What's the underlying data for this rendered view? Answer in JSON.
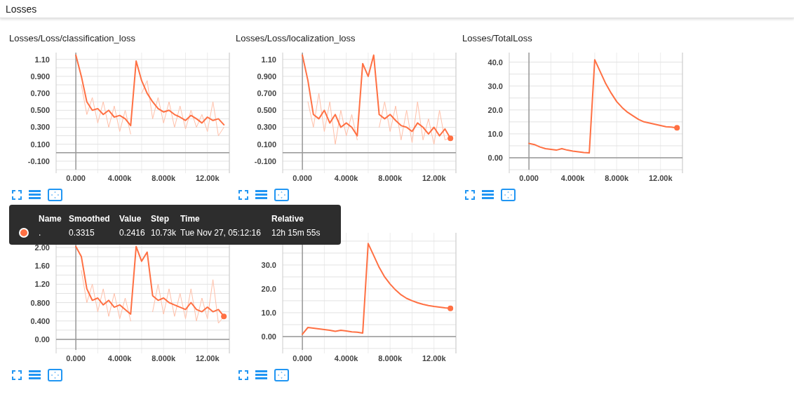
{
  "header": {
    "title": "Losses"
  },
  "charts": [
    {
      "title": "Losses/Loss/classification_loss",
      "end_marker": false,
      "chart_data": {
        "type": "line",
        "grid": true,
        "x": [
          0,
          500,
          1000,
          1500,
          2000,
          2500,
          3000,
          3500,
          4000,
          4500,
          5000,
          5500,
          6000,
          6500,
          7000,
          7500,
          8000,
          8500,
          9000,
          9500,
          10000,
          10500,
          11000,
          11500,
          12000,
          12500,
          13000,
          13500
        ],
        "xlim": [
          -1800,
          14000
        ],
        "ylim": [
          -0.2,
          1.18
        ],
        "xticks": [
          {
            "value": 0,
            "label": "0.000"
          },
          {
            "value": 4000,
            "label": "4.000k"
          },
          {
            "value": 8000,
            "label": "8.000k"
          },
          {
            "value": 12000,
            "label": "12.00k"
          }
        ],
        "yticks": [
          {
            "value": -0.1,
            "label": "-0.100"
          },
          {
            "value": 0.1,
            "label": "0.100"
          },
          {
            "value": 0.3,
            "label": "0.300"
          },
          {
            "value": 0.5,
            "label": "0.500"
          },
          {
            "value": 0.7,
            "label": "0.700"
          },
          {
            "value": 0.9,
            "label": "0.900"
          },
          {
            "value": 1.1,
            "label": "1.10"
          }
        ],
        "series": [
          {
            "color": "#ffbfa8",
            "values": [
              null,
              0.8,
              0.45,
              0.65,
              0.35,
              0.6,
              0.3,
              0.55,
              0.25,
              0.5,
              0.22,
              null,
              0.7,
              0.85,
              0.4,
              0.65,
              0.35,
              0.6,
              0.3,
              0.55,
              0.28,
              0.5,
              0.3,
              0.45,
              0.25,
              0.6,
              0.2,
              0.3
            ]
          },
          {
            "color": "#ff7043",
            "values": [
              1.15,
              0.9,
              0.6,
              0.5,
              0.52,
              0.45,
              0.5,
              0.42,
              0.44,
              0.4,
              0.32,
              1.08,
              0.85,
              0.7,
              0.6,
              0.52,
              0.48,
              0.5,
              0.45,
              0.42,
              0.38,
              0.44,
              0.4,
              0.35,
              0.42,
              0.38,
              0.4,
              0.33
            ]
          }
        ]
      }
    },
    {
      "title": "Losses/Loss/localization_loss",
      "end_marker": true,
      "chart_data": {
        "type": "line",
        "grid": true,
        "x": [
          0,
          500,
          1000,
          1500,
          2000,
          2500,
          3000,
          3500,
          4000,
          4500,
          5000,
          5500,
          6000,
          6500,
          7000,
          7500,
          8000,
          8500,
          9000,
          9500,
          10000,
          10500,
          11000,
          11500,
          12000,
          12500,
          13000,
          13500
        ],
        "xlim": [
          -1800,
          14000
        ],
        "ylim": [
          -0.2,
          1.18
        ],
        "xticks": [
          {
            "value": 0,
            "label": "0.000"
          },
          {
            "value": 4000,
            "label": "4.000k"
          },
          {
            "value": 8000,
            "label": "8.000k"
          },
          {
            "value": 12000,
            "label": "12.00k"
          }
        ],
        "yticks": [
          {
            "value": -0.1,
            "label": "-0.100"
          },
          {
            "value": 0.1,
            "label": "0.100"
          },
          {
            "value": 0.3,
            "label": "0.300"
          },
          {
            "value": 0.5,
            "label": "0.500"
          },
          {
            "value": 0.7,
            "label": "0.700"
          },
          {
            "value": 0.9,
            "label": "0.900"
          },
          {
            "value": 1.1,
            "label": "1.10"
          }
        ],
        "series": [
          {
            "color": "#ffbfa8",
            "values": [
              null,
              0.6,
              0.3,
              0.7,
              0.25,
              0.6,
              0.1,
              0.5,
              0.2,
              0.45,
              0.15,
              null,
              null,
              null,
              0.3,
              0.6,
              0.25,
              0.55,
              0.15,
              0.5,
              0.12,
              0.6,
              0.15,
              0.4,
              0.1,
              0.5,
              0.15,
              0.18
            ]
          },
          {
            "color": "#ff7043",
            "values": [
              1.15,
              0.85,
              0.45,
              0.4,
              0.5,
              0.35,
              0.45,
              0.3,
              0.35,
              0.3,
              0.2,
              1.05,
              0.9,
              1.15,
              0.45,
              0.4,
              0.45,
              0.38,
              0.32,
              0.3,
              0.25,
              0.35,
              0.3,
              0.22,
              0.3,
              0.2,
              0.28,
              0.17
            ]
          }
        ]
      }
    },
    {
      "title": "Losses/TotalLoss",
      "end_marker": true,
      "chart_data": {
        "type": "line",
        "grid": true,
        "x": [
          0,
          500,
          1000,
          1500,
          2000,
          2500,
          3000,
          3500,
          4000,
          4500,
          5000,
          5500,
          6000,
          6500,
          7000,
          7500,
          8000,
          8500,
          9000,
          9500,
          10000,
          10500,
          11000,
          11500,
          12000,
          12500,
          13000,
          13500
        ],
        "xlim": [
          -1800,
          14000
        ],
        "ylim": [
          -5,
          44
        ],
        "xticks": [
          {
            "value": 0,
            "label": "0.000"
          },
          {
            "value": 4000,
            "label": "4.000k"
          },
          {
            "value": 8000,
            "label": "8.000k"
          },
          {
            "value": 12000,
            "label": "12.00k"
          }
        ],
        "yticks": [
          {
            "value": 0,
            "label": "0.00"
          },
          {
            "value": 10,
            "label": "10.0"
          },
          {
            "value": 20,
            "label": "20.0"
          },
          {
            "value": 30,
            "label": "30.0"
          },
          {
            "value": 40,
            "label": "40.0"
          }
        ],
        "series": [
          {
            "color": "#ff7043",
            "values": [
              6,
              5.5,
              4.5,
              3.8,
              3.5,
              3.2,
              3.8,
              3.2,
              2.8,
              2.5,
              2.2,
              2,
              41,
              36,
              31,
              27,
              23.5,
              21,
              19,
              17.5,
              16,
              15,
              14.5,
              14,
              13.5,
              13,
              12.8,
              12.5
            ]
          }
        ]
      }
    },
    {
      "end_marker": true,
      "chart_data": {
        "type": "line",
        "grid": true,
        "x": [
          0,
          500,
          1000,
          1500,
          2000,
          2500,
          3000,
          3500,
          4000,
          4500,
          5000,
          5500,
          6000,
          6500,
          7000,
          7500,
          8000,
          8500,
          9000,
          9500,
          10000,
          10500,
          11000,
          11500,
          12000,
          12500,
          13000,
          13500
        ],
        "xlim": [
          -1800,
          14000
        ],
        "ylim": [
          -0.23,
          2.32
        ],
        "xticks": [
          {
            "value": 0,
            "label": "0.000"
          },
          {
            "value": 4000,
            "label": "4.000k"
          },
          {
            "value": 8000,
            "label": "8.000k"
          },
          {
            "value": 12000,
            "label": "12.00k"
          }
        ],
        "yticks": [
          {
            "value": 0,
            "label": "0.00"
          },
          {
            "value": 0.4,
            "label": "0.400"
          },
          {
            "value": 0.8,
            "label": "0.800"
          },
          {
            "value": 1.2,
            "label": "1.20"
          },
          {
            "value": 1.6,
            "label": "1.60"
          },
          {
            "value": 2,
            "label": "2.00"
          }
        ],
        "series": [
          {
            "color": "#ffbfa8",
            "values": [
              null,
              1.5,
              0.8,
              1.2,
              0.6,
              1.1,
              0.5,
              1.0,
              0.45,
              0.9,
              0.4,
              null,
              null,
              null,
              0.6,
              1.2,
              0.55,
              1.1,
              0.5,
              1.0,
              0.45,
              1.1,
              0.4,
              0.9,
              0.45,
              1.3,
              0.35,
              0.5
            ]
          },
          {
            "color": "#ff7043",
            "values": [
              2.02,
              1.8,
              1.1,
              0.85,
              0.9,
              0.75,
              0.85,
              0.7,
              0.75,
              0.65,
              0.55,
              2.02,
              1.7,
              1.9,
              0.95,
              0.85,
              0.9,
              0.8,
              0.75,
              0.7,
              0.65,
              0.8,
              0.65,
              0.6,
              0.7,
              0.6,
              0.65,
              0.5
            ]
          }
        ]
      }
    },
    {
      "end_marker": true,
      "chart_data": {
        "type": "line",
        "grid": true,
        "x": [
          0,
          500,
          1000,
          1500,
          2000,
          2500,
          3000,
          3500,
          4000,
          4500,
          5000,
          5500,
          6000,
          6500,
          7000,
          7500,
          8000,
          8500,
          9000,
          9500,
          10000,
          10500,
          11000,
          11500,
          12000,
          12500,
          13000,
          13500
        ],
        "xlim": [
          -1800,
          14000
        ],
        "ylim": [
          -5.6,
          43.5
        ],
        "xticks": [
          {
            "value": 0,
            "label": "0.000"
          },
          {
            "value": 4000,
            "label": "4.000k"
          },
          {
            "value": 8000,
            "label": "8.000k"
          },
          {
            "value": 12000,
            "label": "12.00k"
          }
        ],
        "yticks": [
          {
            "value": 0,
            "label": "0.00"
          },
          {
            "value": 10,
            "label": "10.0"
          },
          {
            "value": 20,
            "label": "20.0"
          },
          {
            "value": 30,
            "label": "30.0"
          }
        ],
        "series": [
          {
            "color": "#ff7043",
            "values": [
              1,
              3.8,
              3.5,
              3.2,
              2.9,
              2.6,
              2.2,
              2.6,
              2.3,
              2,
              1.8,
              1.5,
              39,
              34,
              29,
              25,
              22,
              19.5,
              17.5,
              16,
              15,
              14.2,
              13.5,
              13,
              12.6,
              12.3,
              12,
              11.8
            ]
          }
        ]
      }
    }
  ],
  "tooltip": {
    "columns": [
      "Name",
      "Smoothed",
      "Value",
      "Step",
      "Time",
      "Relative"
    ],
    "rows": [
      {
        "color": "#ff7043",
        "cells": [
          ".",
          "0.3315",
          "0.2416",
          "10.73k",
          "Tue Nov 27, 05:12:16",
          "12h 15m 55s"
        ]
      }
    ]
  }
}
